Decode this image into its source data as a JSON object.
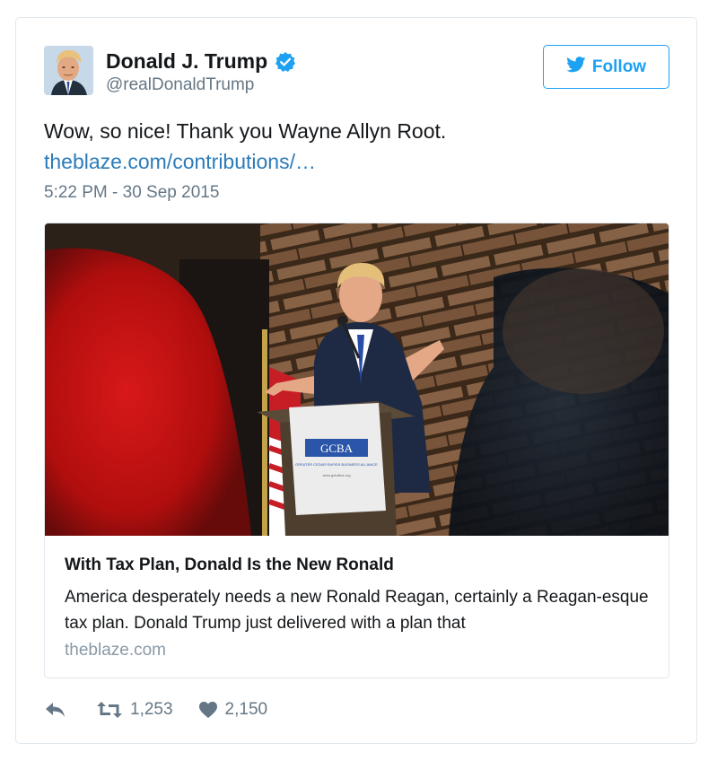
{
  "tweet": {
    "author": {
      "name": "Donald J. Trump",
      "handle": "@realDonaldTrump",
      "verified": true
    },
    "follow_label": "Follow",
    "text": "Wow, so nice! Thank you Wayne Allyn Root.",
    "link_text": "theblaze.com/contributions/…",
    "timestamp": "5:22 PM - 30 Sep 2015",
    "card": {
      "title": "With Tax Plan, Donald Is the New Ronald",
      "description": "America desperately needs a new Ronald Reagan, certainly a Reagan-esque tax plan. Donald Trump just delivered with a plan that",
      "domain": "theblaze.com",
      "podium_sign": {
        "logo": "GCBA",
        "subtitle": "GREATER CEDAR RAPIDS BUSINESS ALLIANCE",
        "url": "www.gcbalive.org"
      }
    },
    "stats": {
      "retweets": "1,253",
      "likes": "2,150"
    }
  },
  "icons": {
    "verified": "verified-badge-icon",
    "follow": "twitter-bird-icon",
    "reply": "reply-icon",
    "retweet": "retweet-icon",
    "like": "heart-icon"
  },
  "colors": {
    "accent": "#1da1f2",
    "link": "#2b7bb9",
    "muted": "#657786",
    "border": "#e1e8ed",
    "domain": "#8899a6"
  }
}
